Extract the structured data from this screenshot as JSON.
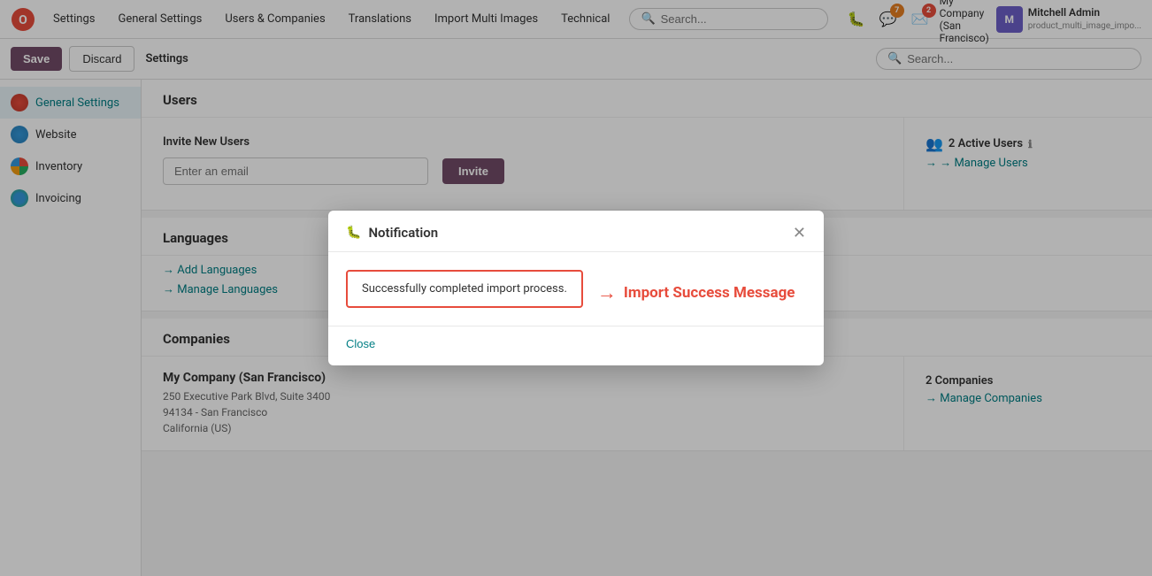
{
  "topnav": {
    "brand_icon_alt": "Odoo",
    "items": [
      {
        "label": "Settings",
        "id": "settings"
      },
      {
        "label": "General Settings",
        "id": "general-settings"
      },
      {
        "label": "Users & Companies",
        "id": "users-companies"
      },
      {
        "label": "Translations",
        "id": "translations"
      },
      {
        "label": "Import Multi Images",
        "id": "import-multi-images"
      },
      {
        "label": "Technical",
        "id": "technical"
      }
    ],
    "search_placeholder": "Search...",
    "notifications_badge": "7",
    "messages_badge": "2",
    "company": "My Company (San Francisco)",
    "user_name": "Mitchell Admin",
    "user_subtitle": "product_multi_image_impo..."
  },
  "toolbar": {
    "save_label": "Save",
    "discard_label": "Discard",
    "settings_label": "Settings"
  },
  "sidebar": {
    "items": [
      {
        "label": "General Settings",
        "icon": "general",
        "active": true
      },
      {
        "label": "Website",
        "icon": "website",
        "active": false
      },
      {
        "label": "Inventory",
        "icon": "inventory",
        "active": false
      },
      {
        "label": "Invoicing",
        "icon": "invoicing",
        "active": false
      }
    ]
  },
  "content": {
    "users_section": {
      "title": "Users",
      "invite_label": "Invite New Users",
      "invite_placeholder": "Enter an email",
      "invite_btn": "Invite",
      "active_users_count": "2 Active Users",
      "active_users_info": "ⓘ",
      "manage_users_label": "→ Manage Users"
    },
    "languages_section": {
      "title": "Languages",
      "add_label": "→ Add Languages",
      "manage_label": "→ Manage Languages"
    },
    "companies_section": {
      "title": "Companies",
      "company_name": "My Company (San Francisco)",
      "company_addr1": "250 Executive Park Blvd, Suite 3400",
      "company_addr2": "94134 - San Francisco",
      "company_addr3": "California (US)",
      "companies_count": "2 Companies",
      "manage_companies_label": "→ Manage Companies"
    }
  },
  "dialog": {
    "title": "Notification",
    "bug_icon": "🐛",
    "success_message": "Successfully completed import process.",
    "close_label": "Close",
    "annotation_arrow": "→",
    "annotation_text": "Import Success Message"
  }
}
